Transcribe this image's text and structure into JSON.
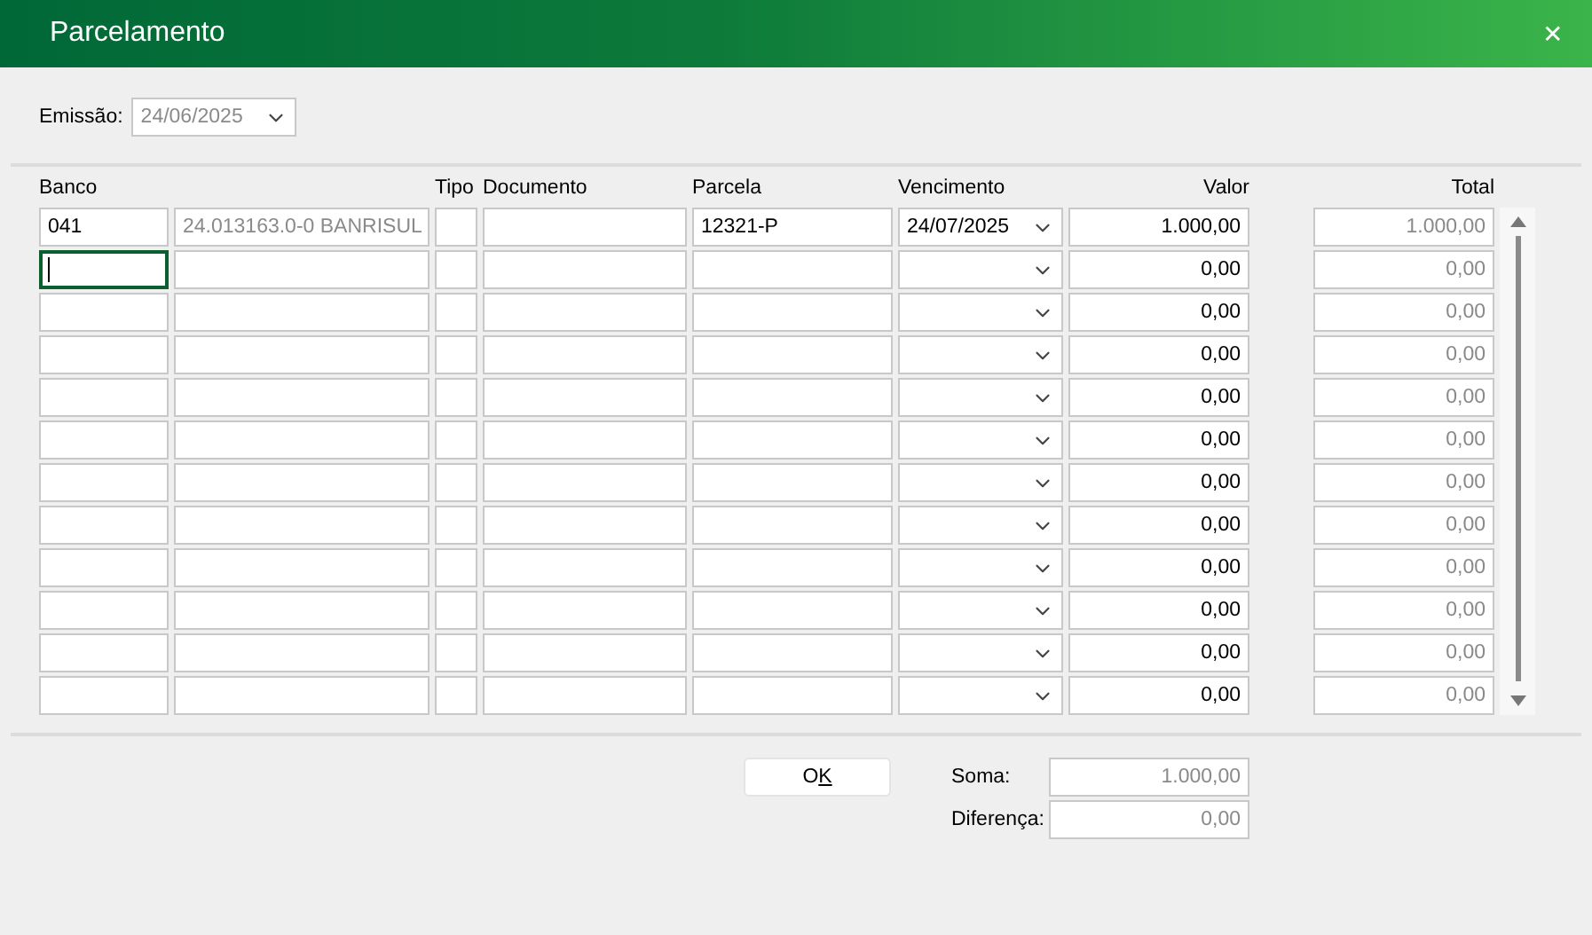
{
  "window": {
    "title": "Parcelamento",
    "close": "✕"
  },
  "emissao": {
    "label": "Emissão:",
    "value": "24/06/2025"
  },
  "table": {
    "columns": [
      "Banco",
      "Tipo",
      "Documento",
      "Parcela",
      "Vencimento",
      "Valor",
      "Total"
    ],
    "rows": [
      {
        "banco": "041",
        "descricao": "24.013163.0-0 BANRISUL",
        "parcela": "12321-P",
        "vencimento": "24/07/2025",
        "valor": "1.000,00",
        "total": "1.000,00",
        "focused": false
      },
      {
        "valor": "0,00",
        "total": "0,00",
        "focused": true
      },
      {
        "valor": "0,00",
        "total": "0,00",
        "focused": false
      },
      {
        "valor": "0,00",
        "total": "0,00",
        "focused": false
      },
      {
        "valor": "0,00",
        "total": "0,00",
        "focused": false
      },
      {
        "valor": "0,00",
        "total": "0,00",
        "focused": false
      },
      {
        "valor": "0,00",
        "total": "0,00",
        "focused": false
      },
      {
        "valor": "0,00",
        "total": "0,00",
        "focused": false
      },
      {
        "valor": "0,00",
        "total": "0,00",
        "focused": false
      },
      {
        "valor": "0,00",
        "total": "0,00",
        "focused": false
      },
      {
        "valor": "0,00",
        "total": "0,00",
        "focused": false
      },
      {
        "valor": "0,00",
        "total": "0,00",
        "focused": false
      }
    ]
  },
  "ok_button": {
    "label_parts": [
      {
        "text": "O",
        "underlined": false
      },
      {
        "text": "K",
        "underlined": true
      }
    ]
  },
  "totals": [
    {
      "label": "Soma:",
      "value": "1.000,00"
    },
    {
      "label": "Diferença:",
      "value": "0,00"
    }
  ]
}
